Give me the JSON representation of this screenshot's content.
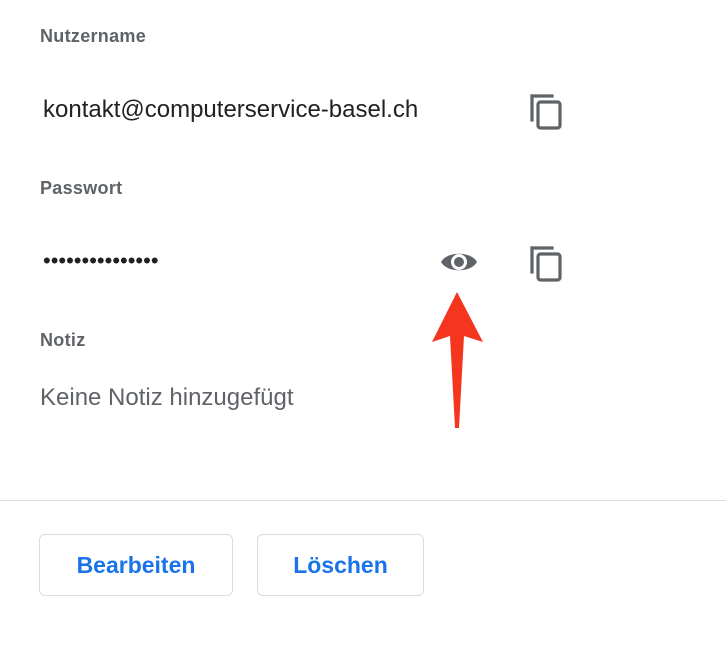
{
  "credential": {
    "username": {
      "label": "Nutzername",
      "value": "kontakt@computerservice-basel.ch",
      "copy_icon": "copy-icon"
    },
    "password": {
      "label": "Passwort",
      "value": "•••••••••••••••",
      "reveal_icon": "eye-icon",
      "copy_icon": "copy-icon"
    },
    "note": {
      "label": "Notiz",
      "value": "Keine Notiz hinzugefügt"
    }
  },
  "actions": {
    "edit_label": "Bearbeiten",
    "delete_label": "Löschen"
  },
  "colors": {
    "accent": "#1a73e8",
    "icon": "#5f6368",
    "annotation_arrow": "#f5361f"
  }
}
